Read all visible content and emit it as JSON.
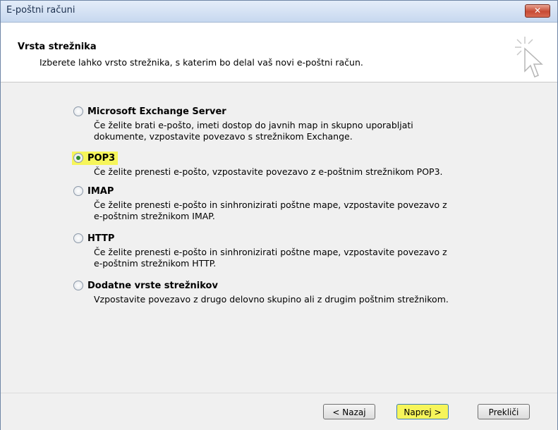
{
  "window": {
    "title": "E-poštni računi",
    "close_glyph": "✕"
  },
  "header": {
    "title": "Vrsta strežnika",
    "subtitle": "Izberete lahko vrsto strežnika, s katerim bo delal vaš novi e-poštni račun.",
    "icon": "wizard-cursor-icon"
  },
  "options": [
    {
      "label": "Microsoft Exchange Server",
      "selected": false,
      "desc_line1": "Če želite brati e-pošto, imeti dostop do javnih map in skupno uporabljati",
      "desc_line2": "dokumente, vzpostavite povezavo s strežnikom Exchange."
    },
    {
      "label": "POP3",
      "selected": true,
      "desc_line1": "Če želite prenesti e-pošto, vzpostavite povezavo z e-poštnim strežnikom POP3.",
      "desc_line2": ""
    },
    {
      "label": "IMAP",
      "selected": false,
      "desc_line1": "Če želite prenesti e-pošto in sinhronizirati poštne mape, vzpostavite povezavo z",
      "desc_line2": "e-poštnim strežnikom IMAP."
    },
    {
      "label": "HTTP",
      "selected": false,
      "desc_line1": "Če želite prenesti e-pošto in sinhronizirati poštne mape, vzpostavite povezavo z",
      "desc_line2": "e-poštnim strežnikom HTTP."
    },
    {
      "label": "Dodatne vrste strežnikov",
      "selected": false,
      "desc_line1": "Vzpostavite povezavo z drugo delovno skupino ali z drugim poštnim strežnikom.",
      "desc_line2": ""
    }
  ],
  "buttons": {
    "back": "< Nazaj",
    "next": "Naprej >",
    "cancel": "Prekliči"
  },
  "colors": {
    "highlight": "#f6f55a",
    "selected_dot": "#2e8b2e"
  }
}
